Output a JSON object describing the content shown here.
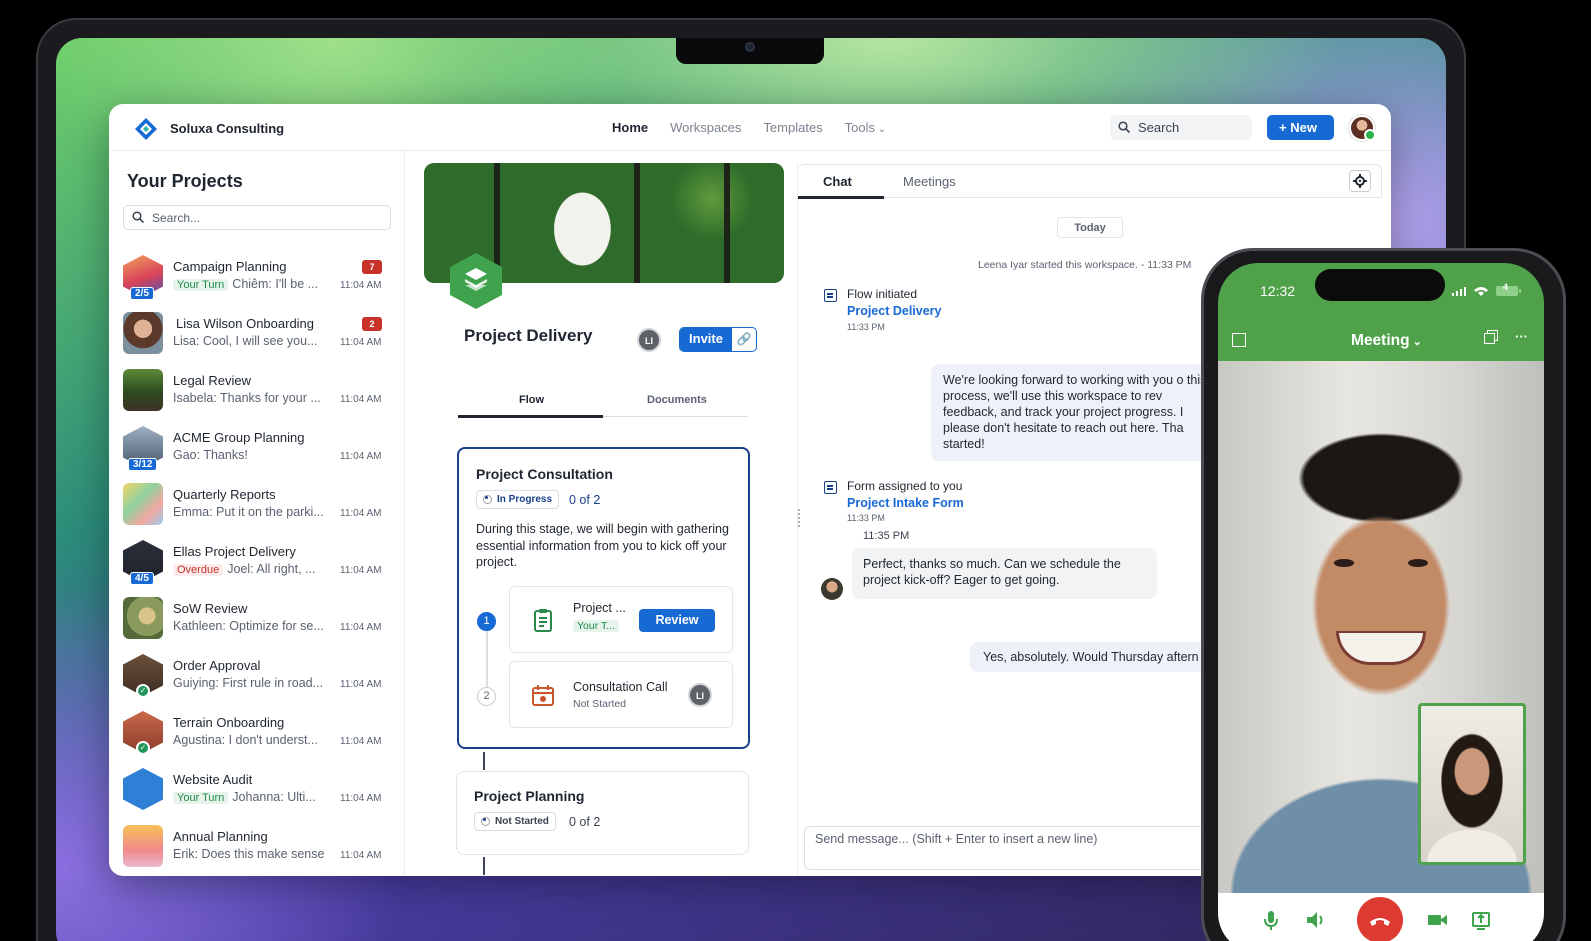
{
  "app": {
    "brand": "Soluxa Consulting",
    "nav": [
      "Home",
      "Workspaces",
      "Templates",
      "Tools"
    ],
    "search_label": "Search",
    "new_label": "New",
    "accent_color": "#1769d4",
    "brand_green": "#3fa34d"
  },
  "sidebar": {
    "title": "Your Projects",
    "search_placeholder": "Search...",
    "projects": [
      {
        "name": "Campaign Planning",
        "tag": "Your Turn",
        "message": "Chiêm: I'll be ...",
        "time": "11:04 AM",
        "count": "7",
        "badge": "2/5"
      },
      {
        "name": "Lisa Wilson Onboarding",
        "message": "Lisa: Cool, I will see you...",
        "time": "11:04 AM",
        "count": "2"
      },
      {
        "name": "Legal Review",
        "message": "Isabela: Thanks for your ...",
        "time": "11:04 AM"
      },
      {
        "name": "ACME Group Planning",
        "message": "Gao: Thanks!",
        "time": "11:04 AM",
        "badge": "3/12"
      },
      {
        "name": "Quarterly Reports",
        "message": "Emma: Put it on the parki...",
        "time": "11:04 AM"
      },
      {
        "name": "Ellas Project Delivery",
        "tag": "Overdue",
        "message": "Joel: All right, ...",
        "time": "11:04 AM",
        "badge": "4/5"
      },
      {
        "name": "SoW Review",
        "message": "Kathleen: Optimize for se...",
        "time": "11:04 AM"
      },
      {
        "name": "Order Approval",
        "message": "Guiying: First rule in road...",
        "time": "11:04 AM"
      },
      {
        "name": "Terrain Onboarding",
        "message": "Agustina: I don't underst...",
        "time": "11:04 AM"
      },
      {
        "name": "Website Audit",
        "tag": "Your Turn",
        "message": "Johanna: Ulti...",
        "time": "11:04 AM"
      },
      {
        "name": "Annual Planning",
        "message": "Erik: Does this make sense",
        "time": "11:04 AM"
      }
    ]
  },
  "workspace": {
    "title": "Project Delivery",
    "member_initials": "LI",
    "invite_label": "Invite",
    "tabs": [
      "Flow",
      "Documents"
    ],
    "stages": [
      {
        "title": "Project Consultation",
        "status": "In Progress",
        "count": "0 of 2",
        "description": "During this stage, we will begin with gathering essential information from you to kick off your project.",
        "steps": [
          {
            "num": "1",
            "name": "Project ...",
            "sub": "Your T...",
            "action": "Review"
          },
          {
            "num": "2",
            "name": "Consultation Call",
            "sub": "Not Started",
            "assignee": "LI"
          }
        ]
      },
      {
        "title": "Project Planning",
        "status": "Not Started",
        "count": "0 of 2"
      }
    ]
  },
  "chat": {
    "tabs": [
      "Chat",
      "Meetings"
    ],
    "day_label": "Today",
    "system_line": "Leena Iyar started this workspace. - 11:33 PM",
    "events": [
      {
        "title": "Flow initiated",
        "link": "Project Delivery",
        "time": "11:33 PM"
      },
      {
        "title": "Form assigned to you",
        "link": "Project Intake Form",
        "time": "11:33 PM"
      }
    ],
    "welcome_message": "We're looking forward to working with you o this process, we'll use this workspace to rev feedback, and track your project progress. I please don't hesitate to reach out here. Tha started!",
    "reply_time": "11:35 PM",
    "reply_message": "Perfect, thanks so much. Can we schedule the project kick-off? Eager to get going.",
    "answer_message": "Yes, absolutely. Would Thursday aftern",
    "composer_placeholder": "Send message... (Shift + Enter to insert a new line)"
  },
  "phone": {
    "time": "12:32",
    "battery": "4",
    "meeting_title": "Meeting"
  }
}
